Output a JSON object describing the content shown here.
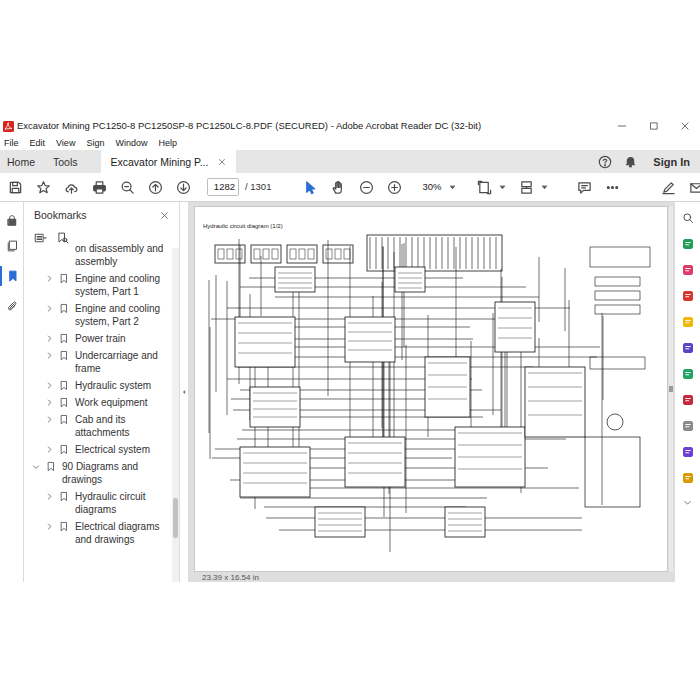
{
  "window": {
    "title": "Excavator Mining PC1250-8 PC1250SP-8 PC1250LC-8.PDF (SECURED) - Adobe Acrobat Reader DC (32-bit)"
  },
  "menu": [
    "File",
    "Edit",
    "View",
    "Sign",
    "Window",
    "Help"
  ],
  "tabs": [
    {
      "label": "Home",
      "selected": false
    },
    {
      "label": "Tools",
      "selected": false
    },
    {
      "label": "Excavator Mining P...",
      "selected": true
    }
  ],
  "account": {
    "sign_in": "Sign In"
  },
  "toolbar": {
    "page": "1282",
    "page_total": "/ 1301",
    "zoom": "30%"
  },
  "bookmarks": {
    "title": "Bookmarks",
    "items": [
      {
        "label": "on disassembly and assembly",
        "kind": "partial",
        "level": 1,
        "expanded": false
      },
      {
        "label": "Engine and cooling system, Part 1",
        "kind": "bookmark",
        "level": 1,
        "expanded": false
      },
      {
        "label": "Engine and cooling system, Part 2",
        "kind": "bookmark",
        "level": 1,
        "expanded": false
      },
      {
        "label": "Power train",
        "kind": "bookmark",
        "level": 1,
        "expanded": false
      },
      {
        "label": "Undercarriage and frame",
        "kind": "bookmark",
        "level": 1,
        "expanded": false
      },
      {
        "label": "Hydraulic system",
        "kind": "bookmark",
        "level": 1,
        "expanded": false
      },
      {
        "label": "Work equipment",
        "kind": "bookmark",
        "level": 1,
        "expanded": false
      },
      {
        "label": "Cab and its attachments",
        "kind": "bookmark",
        "level": 1,
        "expanded": false
      },
      {
        "label": "Electrical system",
        "kind": "bookmark",
        "level": 1,
        "expanded": false
      },
      {
        "label": "90 Diagrams and drawings",
        "kind": "bookmark",
        "level": 0,
        "expanded": true
      },
      {
        "label": "Hydraulic circuit diagrams",
        "kind": "bookmark",
        "level": 1,
        "expanded": false
      },
      {
        "label": "Electrical diagrams and drawings",
        "kind": "bookmark",
        "level": 1,
        "expanded": false
      }
    ]
  },
  "document": {
    "title": "Hydraulic circuit diagram (1/2)"
  },
  "status": {
    "page_size": "23.39 x 16.54 in"
  }
}
